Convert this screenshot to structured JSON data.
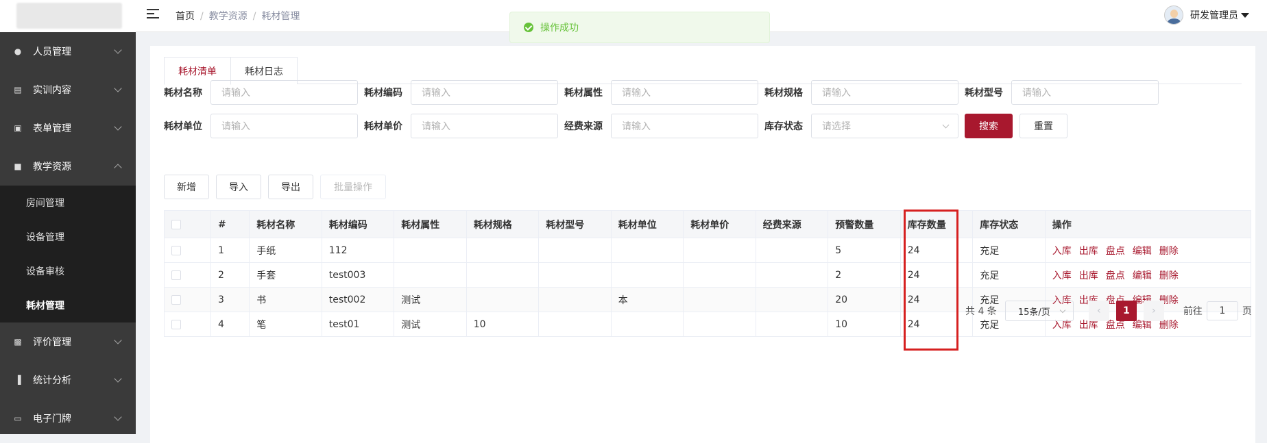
{
  "sidebar": {
    "items": [
      {
        "label": "人员管理",
        "icon": "user-icon"
      },
      {
        "label": "实训内容",
        "icon": "book-icon"
      },
      {
        "label": "表单管理",
        "icon": "form-icon"
      },
      {
        "label": "教学资源",
        "icon": "resource-icon",
        "expanded": true
      },
      {
        "label": "评价管理",
        "icon": "chart-card-icon"
      },
      {
        "label": "统计分析",
        "icon": "bar-chart-icon"
      },
      {
        "label": "电子门牌",
        "icon": "monitor-icon"
      }
    ],
    "submenu": [
      "房间管理",
      "设备管理",
      "设备审核",
      "耗材管理"
    ],
    "active_sub": "耗材管理"
  },
  "header": {
    "breadcrumb": [
      "首页",
      "教学资源",
      "耗材管理"
    ],
    "user_name": "研发管理员"
  },
  "toast": {
    "message": "操作成功",
    "color": "#67c23a"
  },
  "tabs": [
    "耗材清单",
    "耗材日志"
  ],
  "form": {
    "row1": [
      {
        "label": "耗材名称",
        "placeholder": "请输入"
      },
      {
        "label": "耗材编码",
        "placeholder": "请输入"
      },
      {
        "label": "耗材属性",
        "placeholder": "请输入"
      },
      {
        "label": "耗材规格",
        "placeholder": "请输入"
      },
      {
        "label": "耗材型号",
        "placeholder": "请输入"
      }
    ],
    "row2": [
      {
        "label": "耗材单位",
        "placeholder": "请输入"
      },
      {
        "label": "耗材单价",
        "placeholder": "请输入"
      },
      {
        "label": "经费来源",
        "placeholder": "请输入"
      },
      {
        "label": "库存状态",
        "placeholder": "请选择"
      }
    ],
    "search_label": "搜索",
    "reset_label": "重置"
  },
  "actions": [
    "新增",
    "导入",
    "导出",
    "批量操作"
  ],
  "table": {
    "headers": [
      "#",
      "耗材名称",
      "耗材编码",
      "耗材属性",
      "耗材规格",
      "耗材型号",
      "耗材单位",
      "耗材单价",
      "经费来源",
      "预警数量",
      "库存数量",
      "库存状态",
      "操作"
    ],
    "rows": [
      [
        "1",
        "手纸",
        "112",
        "",
        "",
        "",
        "",
        "",
        "",
        "5",
        "24",
        "充足"
      ],
      [
        "2",
        "手套",
        "test003",
        "",
        "",
        "",
        "",
        "",
        "",
        "2",
        "24",
        "充足"
      ],
      [
        "3",
        "书",
        "test002",
        "测试",
        "",
        "",
        "本",
        "",
        "",
        "20",
        "24",
        "充足"
      ],
      [
        "4",
        "笔",
        "test01",
        "测试",
        "10",
        "",
        "",
        "",
        "",
        "10",
        "24",
        "充足"
      ]
    ],
    "ops": [
      "入库",
      "出库",
      "盘点",
      "编辑",
      "删除"
    ]
  },
  "pagination": {
    "total_text": "共 4 条",
    "page_size": "15条/页",
    "current_page": "1",
    "goto_prefix": "前往",
    "goto_value": "1",
    "goto_suffix": "页"
  },
  "colors": {
    "brand": "#a8182e",
    "sidebar": "#3a3a3a",
    "highlight_box": "#d62020"
  }
}
